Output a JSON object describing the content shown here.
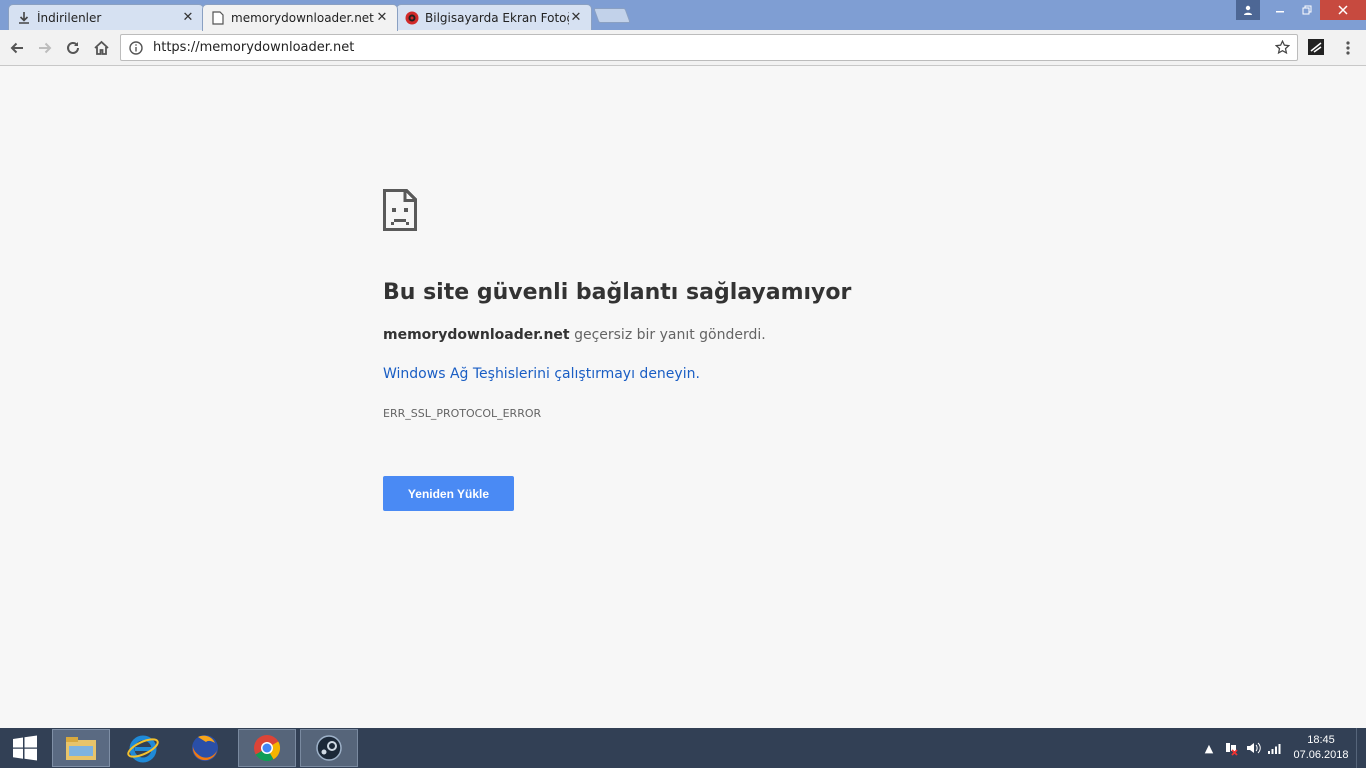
{
  "tabs": [
    {
      "title": "İndirilenler",
      "icon": "download-icon",
      "active": false
    },
    {
      "title": "memorydownloader.net",
      "icon": "page-icon",
      "active": true
    },
    {
      "title": "Bilgisayarda Ekran Fotoğ",
      "icon": "site-favicon-icon",
      "active": false
    }
  ],
  "omnibox": {
    "url": "https://memorydownloader.net"
  },
  "error": {
    "heading": "Bu site güvenli bağlantı sağlayamıyor",
    "host": "memorydownloader.net",
    "summary_rest": " geçersiz bir yanıt gönderdi.",
    "diagnostics_link": "Windows Ağ Teşhislerini çalıştırmayı deneyin.",
    "code": "ERR_SSL_PROTOCOL_ERROR",
    "reload_label": "Yeniden Yükle"
  },
  "taskbar": {
    "apps": [
      "file-explorer-icon",
      "internet-explorer-icon",
      "firefox-icon",
      "chrome-icon",
      "steam-icon"
    ],
    "time": "18:45",
    "date": "07.06.2018"
  },
  "colors": {
    "accent_button": "#4a8af4",
    "link": "#1a5ec4",
    "tab_strip": "#7f9ed3"
  }
}
